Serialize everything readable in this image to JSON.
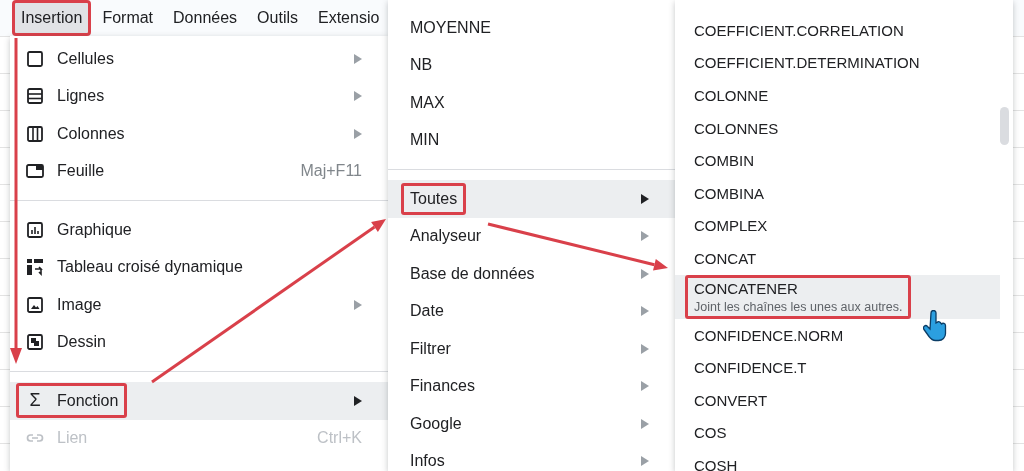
{
  "menu_bar": {
    "items": [
      {
        "label": "Insertion",
        "selected": true,
        "annotated": true
      },
      {
        "label": "Format",
        "selected": false,
        "annotated": false
      },
      {
        "label": "Données",
        "selected": false,
        "annotated": false
      },
      {
        "label": "Outils",
        "selected": false,
        "annotated": false
      },
      {
        "label": "Extensio",
        "selected": false,
        "annotated": false
      }
    ]
  },
  "insert_menu": {
    "groups": [
      [
        {
          "label": "Cellules",
          "kind": "cells",
          "submenu": true,
          "selected": false,
          "disabled": false,
          "annotated": false
        },
        {
          "label": "Lignes",
          "kind": "rows",
          "submenu": true,
          "selected": false,
          "disabled": false,
          "annotated": false
        },
        {
          "label": "Colonnes",
          "kind": "columns",
          "submenu": true,
          "selected": false,
          "disabled": false,
          "annotated": false
        },
        {
          "label": "Feuille",
          "kind": "sheet",
          "shortcut": "Maj+F11",
          "submenu": false,
          "selected": false,
          "disabled": false,
          "annotated": false
        }
      ],
      [
        {
          "label": "Graphique",
          "kind": "chart",
          "submenu": false,
          "selected": false,
          "disabled": false,
          "annotated": false
        },
        {
          "label": "Tableau croisé dynamique",
          "kind": "pivot",
          "submenu": false,
          "selected": false,
          "disabled": false,
          "annotated": false
        },
        {
          "label": "Image",
          "kind": "image",
          "submenu": true,
          "selected": false,
          "disabled": false,
          "annotated": false
        },
        {
          "label": "Dessin",
          "kind": "drawing",
          "submenu": false,
          "selected": false,
          "disabled": false,
          "annotated": false
        }
      ],
      [
        {
          "label": "Fonction",
          "glyph": "Σ",
          "submenu": true,
          "selected": true,
          "disabled": false,
          "annotated": true
        },
        {
          "label": "Lien",
          "kind": "link",
          "shortcut": "Ctrl+K",
          "submenu": false,
          "selected": false,
          "disabled": true,
          "annotated": false
        }
      ]
    ]
  },
  "function_menu": {
    "groups": [
      [
        {
          "label": "MOYENNE",
          "submenu": false,
          "selected": false,
          "annotated": false
        },
        {
          "label": "NB",
          "submenu": false,
          "selected": false,
          "annotated": false
        },
        {
          "label": "MAX",
          "submenu": false,
          "selected": false,
          "annotated": false
        },
        {
          "label": "MIN",
          "submenu": false,
          "selected": false,
          "annotated": false
        }
      ],
      [
        {
          "label": "Toutes",
          "submenu": true,
          "selected": true,
          "annotated": true
        },
        {
          "label": "Analyseur",
          "submenu": true,
          "selected": false,
          "annotated": false
        },
        {
          "label": "Base de données",
          "submenu": true,
          "selected": false,
          "annotated": false
        },
        {
          "label": "Date",
          "submenu": true,
          "selected": false,
          "annotated": false
        },
        {
          "label": "Filtrer",
          "submenu": true,
          "selected": false,
          "annotated": false
        },
        {
          "label": "Finances",
          "submenu": true,
          "selected": false,
          "annotated": false
        },
        {
          "label": "Google",
          "submenu": true,
          "selected": false,
          "annotated": false
        },
        {
          "label": "Infos",
          "submenu": true,
          "selected": false,
          "annotated": false
        }
      ]
    ]
  },
  "all_functions_menu": {
    "items": [
      {
        "label": "COEFFICIENT.CORRELATION",
        "selected": false,
        "annotated": false
      },
      {
        "label": "COEFFICIENT.DETERMINATION",
        "selected": false,
        "annotated": false
      },
      {
        "label": "COLONNE",
        "selected": false,
        "annotated": false
      },
      {
        "label": "COLONNES",
        "selected": false,
        "annotated": false
      },
      {
        "label": "COMBIN",
        "selected": false,
        "annotated": false
      },
      {
        "label": "COMBINA",
        "selected": false,
        "annotated": false
      },
      {
        "label": "COMPLEX",
        "selected": false,
        "annotated": false
      },
      {
        "label": "CONCAT",
        "selected": false,
        "annotated": false
      },
      {
        "label": "CONCATENER",
        "description": "Joint les chaînes les unes aux autres.",
        "selected": true,
        "annotated": true
      },
      {
        "label": "CONFIDENCE.NORM",
        "selected": false,
        "annotated": false
      },
      {
        "label": "CONFIDENCE.T",
        "selected": false,
        "annotated": false
      },
      {
        "label": "CONVERT",
        "selected": false,
        "annotated": false
      },
      {
        "label": "COS",
        "selected": false,
        "annotated": false
      },
      {
        "label": "COSH",
        "selected": false,
        "annotated": false
      }
    ]
  }
}
